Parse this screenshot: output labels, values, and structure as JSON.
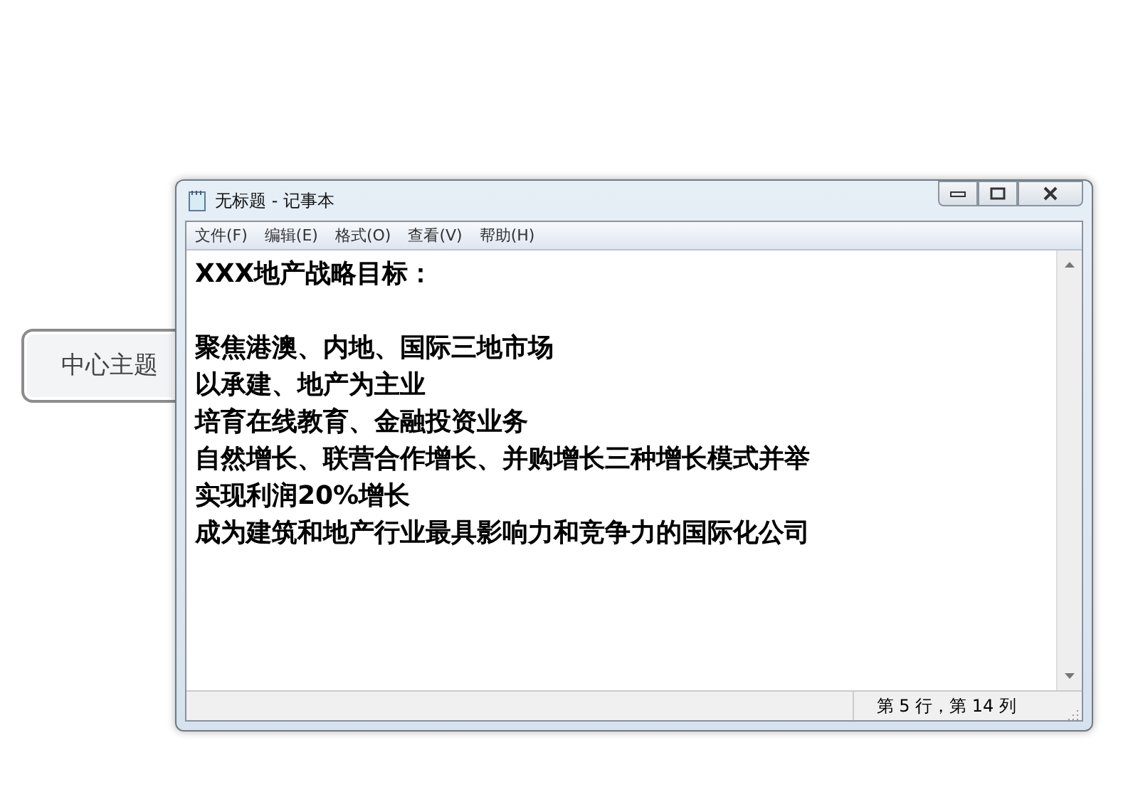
{
  "canvas": {
    "node": {
      "label": "中心主题"
    }
  },
  "window": {
    "title": "无标题 - 记事本"
  },
  "menu": [
    {
      "label": "文件(F)"
    },
    {
      "label": "编辑(E)"
    },
    {
      "label": "格式(O)"
    },
    {
      "label": "查看(V)"
    },
    {
      "label": "帮助(H)"
    }
  ],
  "document": {
    "heading": "XXX地产战略目标：",
    "lines": [
      "聚焦港澳、内地、国际三地市场",
      "以承建、地产为主业",
      "培育在线教育、金融投资业务",
      "自然增长、联营合作增长、并购增长三种增长模式并举",
      "实现利润20%增长",
      "成为建筑和地产行业最具影响力和竞争力的国际化公司"
    ]
  },
  "status_bar": {
    "position": "第 5 行，第 14 列"
  }
}
